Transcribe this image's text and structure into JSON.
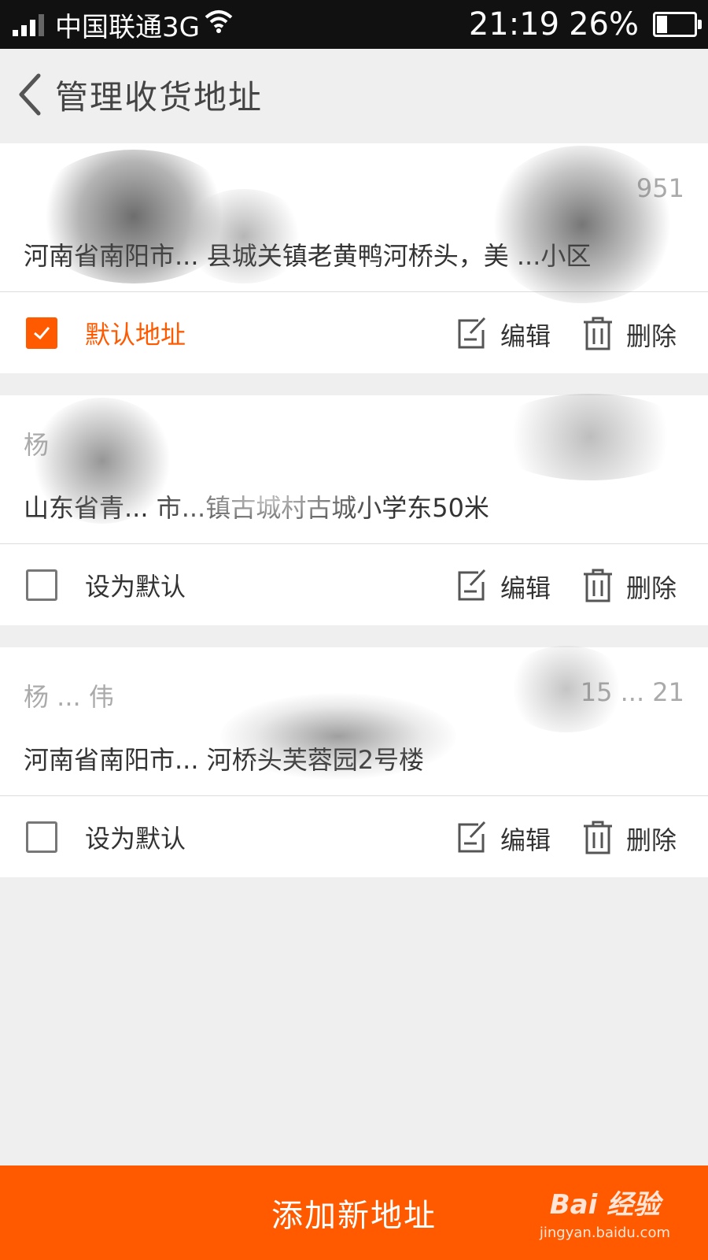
{
  "status_bar": {
    "carrier": "中国联通3G",
    "time": "21:19",
    "battery": "26%",
    "battery_level": 0.26
  },
  "header": {
    "title": "管理收货地址"
  },
  "addresses": [
    {
      "name": "",
      "phone": "951",
      "address": "河南省南阳市... 县城关镇老黄鸭河桥头，美 ...小区",
      "is_default": true,
      "default_label": "默认地址",
      "edit_label": "编辑",
      "delete_label": "删除"
    },
    {
      "name": "杨",
      "phone": "",
      "address": "山东省青... 市...镇古城村古城小学东50米",
      "is_default": false,
      "default_label": "设为默认",
      "edit_label": "编辑",
      "delete_label": "删除"
    },
    {
      "name": "杨 ... 伟",
      "phone": "15 ... 21",
      "address": "河南省南阳市... 河桥头芙蓉园2号楼",
      "is_default": false,
      "default_label": "设为默认",
      "edit_label": "编辑",
      "delete_label": "删除"
    }
  ],
  "bottom_bar": {
    "add_label": "添加新地址"
  },
  "watermark": {
    "main": "Bai  经验",
    "sub": "jingyan.baidu.com"
  },
  "colors": {
    "accent": "#ff5a00",
    "background": "#efefef",
    "status_bar": "#111111"
  }
}
